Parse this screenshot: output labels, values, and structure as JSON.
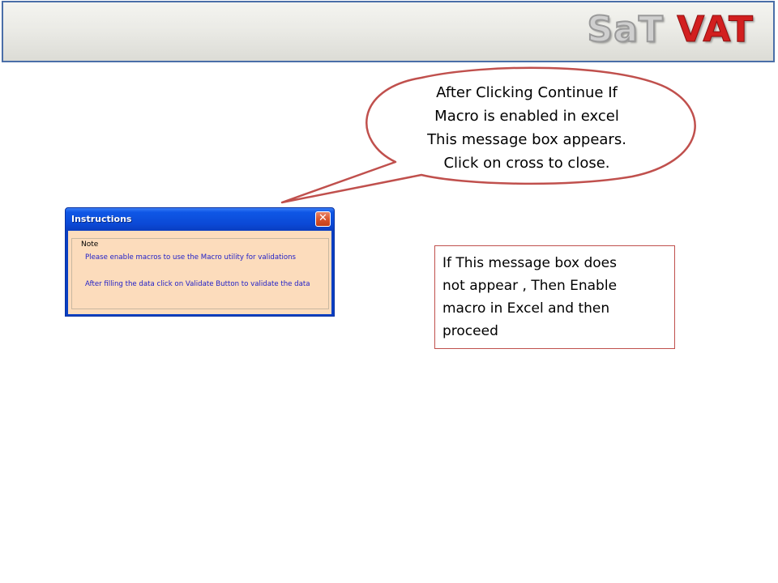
{
  "header": {
    "logo_part1": "SaT",
    "logo_part2": "VAT",
    "border_color": "#4a6ea8"
  },
  "callout": {
    "lines": [
      "After Clicking Continue If",
      "Macro is enabled in excel",
      "This message box appears.",
      "Click on cross to close."
    ],
    "border_color": "#c0504d"
  },
  "dialog": {
    "title": "Instructions",
    "close_icon": "close-icon",
    "group_label": "Note",
    "messages": [
      "Please enable macros to use the Macro utility for validations",
      "After filling the data click on Validate Button to validate the data"
    ],
    "titlebar_color": "#0b49d6",
    "body_color": "#fcdcbc",
    "text_color": "#1d1dc8"
  },
  "info_box": {
    "lines": [
      "If This message box does",
      "not appear , Then Enable",
      "macro in Excel and then",
      "proceed"
    ],
    "border_color": "#c0504d"
  }
}
